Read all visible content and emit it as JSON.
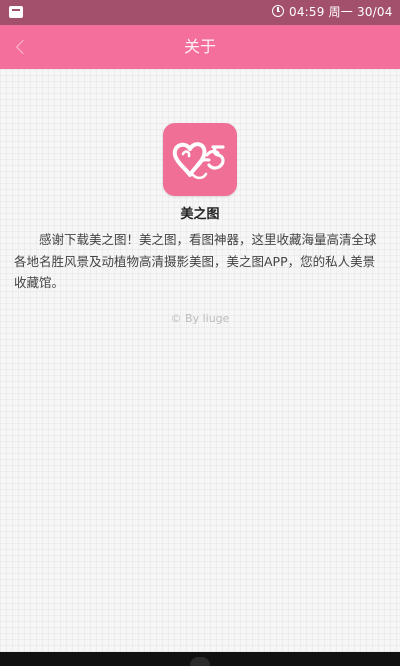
{
  "status_bar": {
    "time_date": "04:59 周一 30/04",
    "icons": [
      "notification-icon",
      "clock-icon"
    ]
  },
  "app_bar": {
    "title": "关于",
    "back_icon": "chevron-left-icon"
  },
  "about": {
    "app_name": "美之图",
    "description": "感谢下载美之图！美之图，看图神器，这里收藏海量高清全球各地名胜风景及动植物高清摄影美图，美之图APP，您的私人美景收藏馆。",
    "byline": "© By liuge"
  },
  "colors": {
    "status_bar": "#a2506b",
    "app_bar": "#f46f9c",
    "logo_bg": "#ef6f96",
    "background": "#f6f6f6"
  }
}
